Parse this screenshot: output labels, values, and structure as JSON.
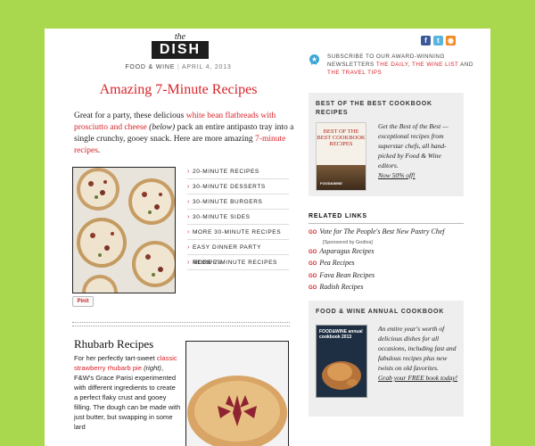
{
  "colors": {
    "accent": "#d8232a",
    "background": "#a9d84e"
  },
  "header": {
    "logo_the": "the",
    "logo_dish": "DISH",
    "publisher": "FOOD & WINE",
    "date": "APRIL 4, 2013"
  },
  "social": {
    "icons": [
      "facebook-icon",
      "twitter-icon",
      "rss-icon"
    ],
    "facebook": "f",
    "twitter": "t",
    "rss": "◉"
  },
  "newsletter": {
    "text": "SUBSCRIBE TO OUR AWARD-WINNING NEWSLETTERS",
    "link1": "THE DAILY",
    "sep1": ",",
    "link2": "THE WINE LIST",
    "and": "AND",
    "link3": "THE TRAVEL TIPS"
  },
  "article1": {
    "title": "Amazing 7-Minute Recipes",
    "intro_a": "Great for a party, these delicious",
    "intro_link": "white bean flatbreads with prosciutto and cheese",
    "intro_paren": "(below)",
    "intro_b": "pack an entire antipasto tray into a single crunchy, gooey snack. Here are more amazing",
    "intro_link2": "7-minute recipes",
    "intro_end": ".",
    "pinit": "Pinit",
    "links": [
      "20-MINUTE RECIPES",
      "30-MINUTE DESSERTS",
      "30-MINUTE BURGERS",
      "30-MINUTE SIDES",
      "MORE 30-MINUTE RECIPES",
      "EASY DINNER PARTY RECIPES",
      "MORE 7-MINUTE RECIPES"
    ]
  },
  "article2": {
    "title": "Rhubarb Recipes",
    "text_a": "For her perfectly tart-sweet",
    "text_link": "classic strawberry rhubarb pie",
    "text_paren": "(right)",
    "text_b": ", F&W's Grace Parisi experimented with different ingredients to create a perfect flaky crust and gooey filling. The dough can be made with just butter, but swapping in some lard"
  },
  "box1": {
    "title": "BEST OF THE BEST COOKBOOK RECIPES",
    "book_title": "BEST OF THE BEST COOKBOOK RECIPES",
    "book_brand": "FOOD&WINE",
    "text": "Get the Best of the Best — exceptional recipes from superstar chefs, all hand-picked by Food & Wine editors.",
    "cta": "Now 50% off!"
  },
  "related": {
    "title": "RELATED LINKS",
    "go": "GO",
    "items": [
      "Vote for The People's Best New Pastry Chef",
      "Asparagus Recipes",
      "Pea Recipes",
      "Fava Bean Recipes",
      "Radish Recipes"
    ],
    "sponsor": "[Sponsored by Godiva]"
  },
  "box2": {
    "title": "FOOD & WINE ANNUAL COOKBOOK",
    "book_title": "FOOD&WINE annual cookbook 2013",
    "text": "An entire year's worth of delicious dishes for all occasions, including fast and fabulous recipes plus new twists on old favorites.",
    "cta": "Grab your FREE book today!"
  }
}
